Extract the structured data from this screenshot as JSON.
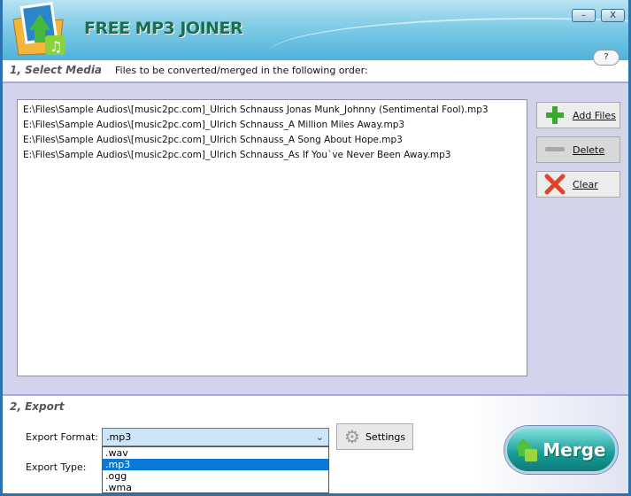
{
  "app": {
    "title": "FREE MP3 JOINER",
    "minimize": "–",
    "close": "X",
    "help": "?"
  },
  "select": {
    "heading": "1, Select Media",
    "instruction": "Files to be converted/merged in the following order:",
    "files": [
      "E:\\Files\\Sample Audios\\[music2pc.com]_Ulrich Schnauss Jonas Munk_Johnny (Sentimental Fool).mp3",
      "E:\\Files\\Sample Audios\\[music2pc.com]_Ulrich Schnauss_A Million Miles Away.mp3",
      "E:\\Files\\Sample Audios\\[music2pc.com]_Ulrich Schnauss_A Song About Hope.mp3",
      "E:\\Files\\Sample Audios\\[music2pc.com]_Ulrich Schnauss_As If You`ve Never Been Away.mp3"
    ],
    "add_files": "Add Files",
    "delete": "Delete",
    "clear": "Clear"
  },
  "export": {
    "heading": "2, Export",
    "format_label": "Export Format:",
    "format_value": ".mp3",
    "type_label": "Export Type:",
    "options": [
      ".wav",
      ".mp3",
      ".ogg",
      ".wma"
    ],
    "selected_option": ".mp3",
    "settings": "Settings",
    "merge": "Merge"
  }
}
